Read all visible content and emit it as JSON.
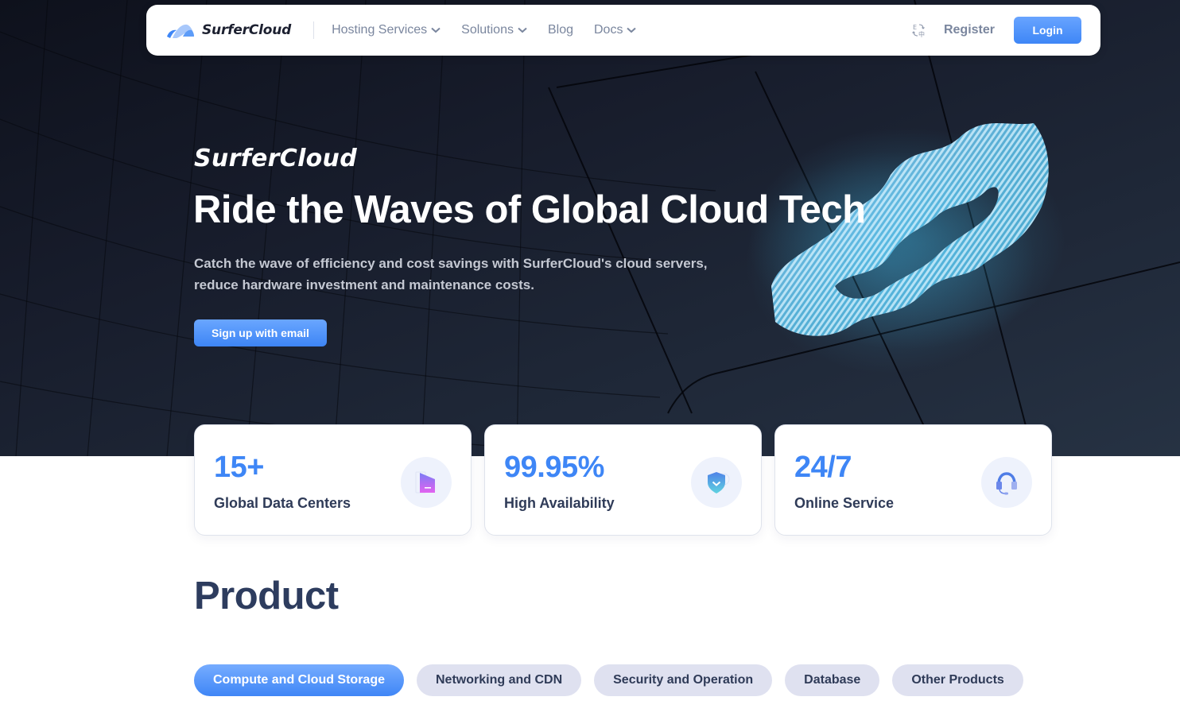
{
  "navbar": {
    "brand": "SurferCloud",
    "menu": [
      {
        "label": "Hosting Services",
        "has_dropdown": true
      },
      {
        "label": "Solutions",
        "has_dropdown": true
      },
      {
        "label": "Blog",
        "has_dropdown": false
      },
      {
        "label": "Docs",
        "has_dropdown": true
      }
    ],
    "language_icon": "language-switch-icon",
    "language_glyphs": {
      "top": "E",
      "bottom": "中"
    },
    "register_label": "Register",
    "login_label": "Login"
  },
  "hero": {
    "brand": "SurferCloud",
    "title": "Ride the Waves of Global Cloud Tech",
    "description": "Catch the wave of efficiency and cost savings with SurferCloud's cloud servers, reduce hardware investment and maintenance costs.",
    "cta_label": "Sign up with email"
  },
  "stats": [
    {
      "value": "15+",
      "label": "Global Data Centers",
      "icon": "data-center-icon"
    },
    {
      "value": "99.95%",
      "label": "High Availability",
      "icon": "shield-check-icon"
    },
    {
      "value": "24/7",
      "label": "Online Service",
      "icon": "headset-icon"
    }
  ],
  "product": {
    "title": "Product",
    "tabs": [
      {
        "label": "Compute and Cloud Storage",
        "active": true
      },
      {
        "label": "Networking and CDN",
        "active": false
      },
      {
        "label": "Security and Operation",
        "active": false
      },
      {
        "label": "Database",
        "active": false
      },
      {
        "label": "Other Products",
        "active": false
      }
    ]
  },
  "colors": {
    "accent": "#3e86f6",
    "hero_bg": "#171c2b",
    "nav_text": "#7a869e",
    "heading_text": "#2d3c5e",
    "tab_inactive_bg": "#dfe1f0"
  }
}
